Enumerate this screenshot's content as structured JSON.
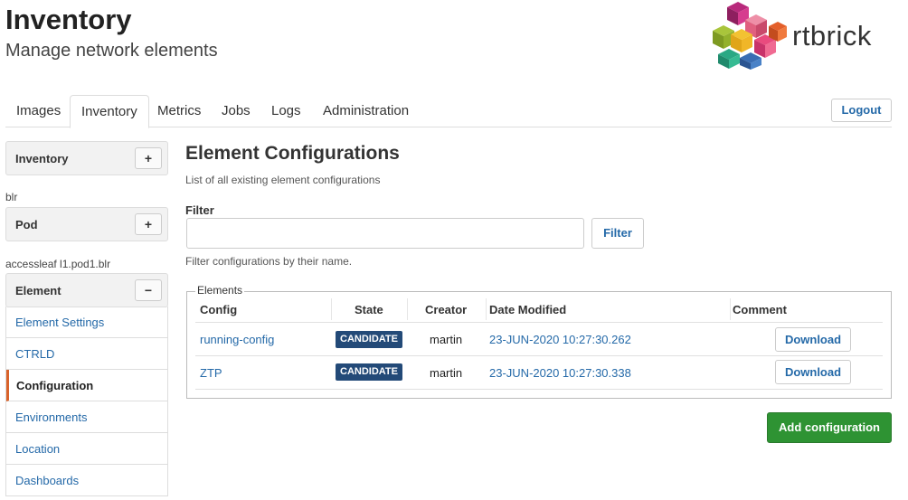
{
  "header": {
    "title": "Inventory",
    "subtitle": "Manage network elements",
    "brand": "rtbrick"
  },
  "tabs": [
    {
      "label": "Images"
    },
    {
      "label": "Inventory"
    },
    {
      "label": "Metrics"
    },
    {
      "label": "Jobs"
    },
    {
      "label": "Logs"
    },
    {
      "label": "Administration"
    }
  ],
  "active_tab": "Inventory",
  "logout_label": "Logout",
  "sidebar": {
    "inventory": {
      "label": "Inventory",
      "button": "+"
    },
    "inventory_value": "blr",
    "pod": {
      "label": "Pod",
      "button": "+"
    },
    "pod_value": "accessleaf l1.pod1.blr",
    "element": {
      "label": "Element",
      "button": "−"
    },
    "items": [
      {
        "label": "Element Settings"
      },
      {
        "label": "CTRLD"
      },
      {
        "label": "Configuration"
      },
      {
        "label": "Environments"
      },
      {
        "label": "Location"
      },
      {
        "label": "Dashboards"
      }
    ],
    "active_item": "Configuration"
  },
  "main": {
    "title": "Element Configurations",
    "description": "List of all existing element configurations",
    "filter_label": "Filter",
    "filter_value": "",
    "filter_button": "Filter",
    "filter_help": "Filter configurations by their name.",
    "legend": "Elements",
    "columns": [
      "Config",
      "State",
      "Creator",
      "Date Modified",
      "Comment"
    ],
    "rows": [
      {
        "config": "running-config",
        "state": "CANDIDATE",
        "creator": "martin",
        "date": "23-JUN-2020 10:27:30.262",
        "action": "Download"
      },
      {
        "config": "ZTP",
        "state": "CANDIDATE",
        "creator": "martin",
        "date": "23-JUN-2020 10:27:30.338",
        "action": "Download"
      }
    ],
    "add_button": "Add configuration"
  },
  "colors": {
    "link": "#2469a8",
    "badge": "#234a78",
    "primary_green": "#2e9333",
    "active_accent": "#d9622a"
  }
}
